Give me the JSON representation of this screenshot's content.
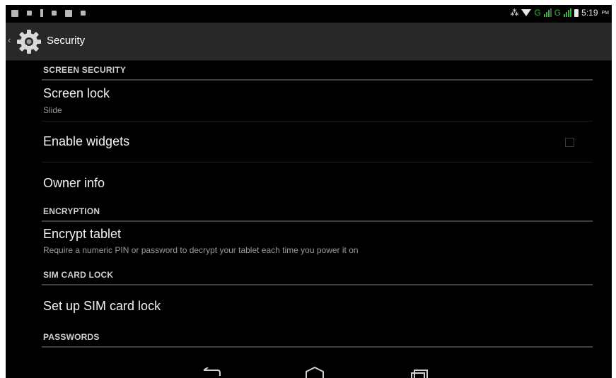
{
  "status_bar": {
    "time": "5:19",
    "ampm": "PM",
    "network_label_1": "G",
    "network_label_2": "G",
    "bluetooth": "bluetooth-icon",
    "wifi": "wifi-icon",
    "battery": "battery-icon"
  },
  "action_bar": {
    "title": "Security",
    "icon": "settings-gear-icon",
    "up_glyph": "‹"
  },
  "sections": {
    "screen_security": "SCREEN SECURITY",
    "encryption": "ENCRYPTION",
    "sim_card_lock": "SIM CARD LOCK",
    "passwords": "PASSWORDS"
  },
  "items": {
    "screen_lock": {
      "title": "Screen lock",
      "summary": "Slide"
    },
    "enable_widgets": {
      "title": "Enable widgets",
      "checked": false
    },
    "owner_info": {
      "title": "Owner info"
    },
    "encrypt_tablet": {
      "title": "Encrypt tablet",
      "summary": "Require a numeric PIN or password to decrypt your tablet each time you power it on"
    },
    "sim_lock": {
      "title": "Set up SIM card lock"
    }
  },
  "navigation": {
    "back": "back-icon",
    "home": "home-icon",
    "recents": "recent-apps-icon"
  },
  "colors": {
    "background": "#000000",
    "action_bar": "#282828",
    "signal_green": "#35b53a",
    "text_primary": "#f0f0f0",
    "text_secondary": "#9a9a9a"
  }
}
